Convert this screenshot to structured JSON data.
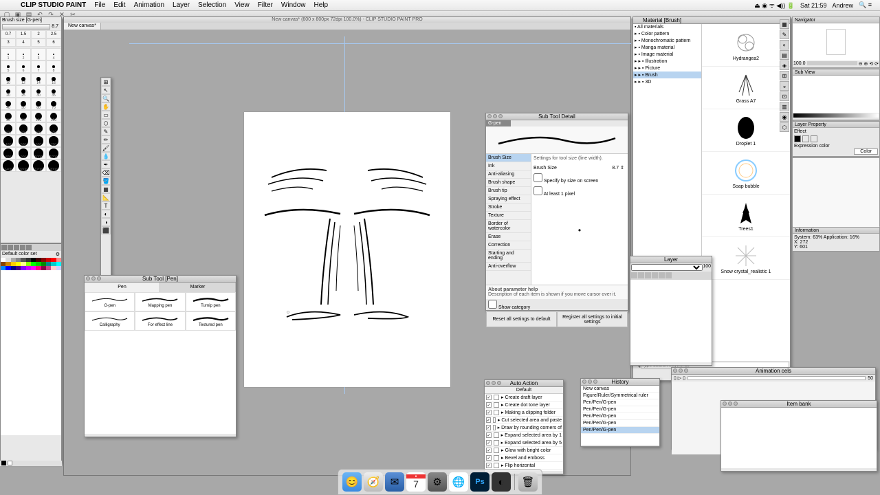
{
  "menubar": {
    "app": "CLIP STUDIO PAINT",
    "items": [
      "File",
      "Edit",
      "Animation",
      "Layer",
      "Selection",
      "View",
      "Filter",
      "Window",
      "Help"
    ],
    "right": {
      "time": "Sat 21:59",
      "user": "Andrew"
    }
  },
  "canvas": {
    "title_bar": "New canvas* (600 x 800px 72dpi 100.0%) - CLIP STUDIO PAINT PRO",
    "tab": "New canvas*"
  },
  "brush_panel": {
    "label": "Brush size [G-pen]",
    "value": "8.7",
    "sizes_row1": [
      "0.7",
      "1.5",
      "2",
      "2.5"
    ],
    "sizes_row2": [
      "3",
      "4",
      "5",
      "6"
    ],
    "rows": [
      [
        1,
        2,
        3,
        4
      ],
      [
        5,
        6,
        7,
        8
      ],
      [
        10,
        12,
        14,
        16
      ],
      [
        20,
        25,
        30,
        35
      ],
      [
        40,
        50,
        60,
        70
      ],
      [
        80,
        90,
        100,
        150
      ],
      [
        200,
        250,
        300,
        350
      ],
      [
        400,
        500,
        600,
        700
      ],
      [
        800,
        900,
        1000,
        1200
      ],
      [
        1400,
        1600,
        1700,
        2000
      ]
    ]
  },
  "color_panel": {
    "label": "Default color set"
  },
  "material": {
    "title": "Material [Brush]",
    "tree": [
      "All materials",
      "Color pattern",
      "Monochromatic pattern",
      "Manga material",
      "Image material",
      "Illustration",
      "Picture",
      "Brush",
      "3D"
    ],
    "selected": "Brush",
    "items": [
      "Hydrangea2",
      "Grass A7",
      "Droplet 1",
      "Soap bubble",
      "Trees1",
      "Snow crystal_realistic 1"
    ],
    "search_placeholder": "Type search keywords"
  },
  "subtool": {
    "title": "Sub Tool [Pen]",
    "tabs": [
      "Pen",
      "Marker"
    ],
    "items": [
      "G-pen",
      "Mapping pen",
      "Turnip pen",
      "Calligraphy",
      "For effect line",
      "Textured pen"
    ]
  },
  "subtool_detail": {
    "title": "Sub Tool Detail",
    "tool": "G-pen",
    "categories": [
      "Brush Size",
      "Ink",
      "Anti-aliasing",
      "Brush shape",
      "Brush tip",
      "Spraying effect",
      "Stroke",
      "Texture",
      "Border of watercolor",
      "Erase",
      "Correction",
      "Starting and ending",
      "Anti-overflow"
    ],
    "selected_cat": "Brush Size",
    "settings_desc": "Settings for tool size (line width).",
    "brush_size_label": "Brush Size",
    "brush_size_value": "8.7",
    "opt1": "Specify by size on screen",
    "opt2": "At least 1 pixel",
    "help_title": "About parameter help",
    "help_text": "Description of each item is shown if you move cursor over it.",
    "show_category": "Show category",
    "btn_reset": "Reset all settings to default",
    "btn_register": "Register all settings to initial settings"
  },
  "autoaction": {
    "title": "Auto Action",
    "set": "Default",
    "items": [
      "Create draft layer",
      "Create dot tone layer",
      "Making a clipping folder",
      "Cut selected area and paste",
      "Draw by rounding corners of",
      "Expand selected area by 1",
      "Expand selected area by 5",
      "Glow with bright color",
      "Bevel and emboss",
      "Flip horizontal"
    ]
  },
  "history": {
    "title": "History",
    "items": [
      "New canvas",
      "Figure/Ruler/Symmetrical ruler",
      "Pen/Pen/G-pen",
      "Pen/Pen/G-pen",
      "Pen/Pen/G-pen",
      "Pen/Pen/G-pen",
      "Pen/Pen/G-pen"
    ]
  },
  "animation": {
    "title": "Animation cels",
    "frames": "50"
  },
  "itembank": {
    "title": "Item bank"
  },
  "layer": {
    "title": "Layer",
    "opacity": "100"
  },
  "navigator": {
    "title": "Navigator",
    "zoom": "100.0"
  },
  "subview": {
    "title": "Sub View"
  },
  "layer_property": {
    "title": "Layer Property",
    "effect": "Effect",
    "expr": "Expression color",
    "mode": "Color"
  },
  "information": {
    "title": "Information",
    "sys": "System: 63% Application: 16%",
    "x": "X: 272",
    "y": "Y: 601"
  },
  "dock": [
    "finder",
    "safari",
    "launchpad",
    "calendar",
    "settings",
    "chrome",
    "photoshop",
    "clipstudio",
    "trash"
  ],
  "calendar_day": "7"
}
